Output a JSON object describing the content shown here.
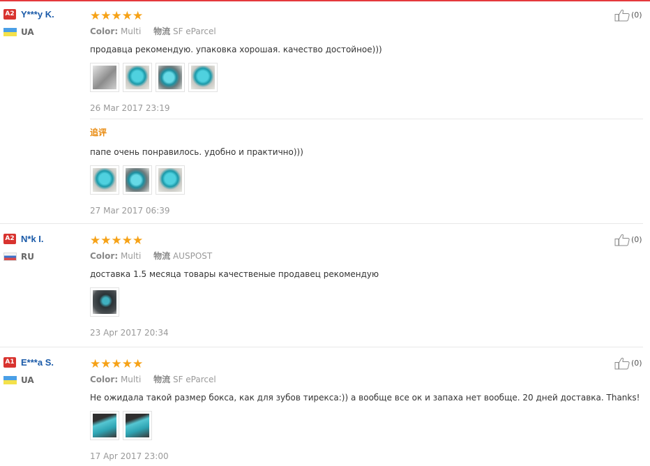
{
  "reviews": [
    {
      "level": "A2",
      "name": "Y***y K.",
      "country": "UA",
      "stars": "★★★★★",
      "color_label": "Color:",
      "color_value": "Multi",
      "shipping_label": "物流",
      "shipping_value": "SF eParcel",
      "text": "продавца рекомендую. упаковка хорошая. качество достойное)))",
      "photos": [
        "gray",
        "teal",
        "teal2",
        "teal"
      ],
      "date": "26 Mar 2017 23:19",
      "likes": "(0)",
      "followup": {
        "label": "追评",
        "text": "папе очень понравилось. удобно и практично)))",
        "photos": [
          "teal",
          "teal2",
          "teal"
        ],
        "date": "27 Mar 2017 06:39"
      }
    },
    {
      "level": "A2",
      "name": "N*k I.",
      "country": "RU",
      "stars": "★★★★★",
      "color_label": "Color:",
      "color_value": "Multi",
      "shipping_label": "物流",
      "shipping_value": "AUSPOST",
      "text": "доставка 1.5 месяца товары качественые продавец рекомендую",
      "photos": [
        "dark"
      ],
      "date": "23 Apr 2017 20:34",
      "likes": "(0)"
    },
    {
      "level": "A1",
      "name": "E***a S.",
      "country": "UA",
      "stars": "★★★★★",
      "color_label": "Color:",
      "color_value": "Multi",
      "shipping_label": "物流",
      "shipping_value": "SF eParcel",
      "text": "Не ожидала такой размер бокса, как для зубов тирекса:)) а вообще все ок и запаха нет вообще. 20 дней доставка. Thanks!",
      "photos": [
        "teal3",
        "teal3"
      ],
      "date": "17 Apr 2017 23:00",
      "likes": "(0)"
    }
  ],
  "colors": {
    "accent_line": "#e4393c",
    "level_badge": "#d8332f",
    "name": "#1a5aa8",
    "stars": "#f6a217",
    "followup": "#e8880a"
  },
  "icons": {
    "like": "thumbs-up-icon",
    "flag_ua": "ukraine-flag-icon",
    "flag_ru": "russia-flag-icon",
    "star": "star-icon"
  }
}
